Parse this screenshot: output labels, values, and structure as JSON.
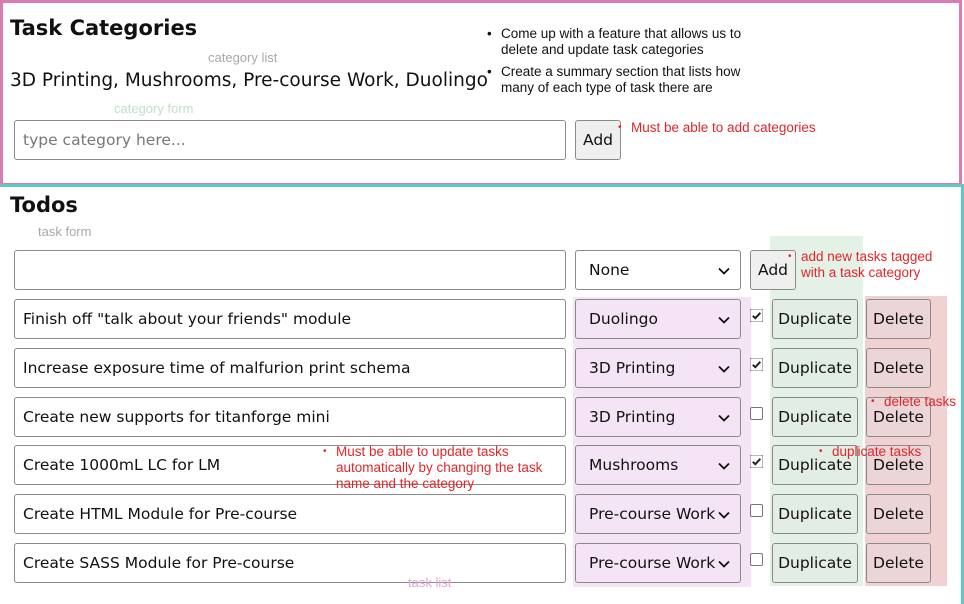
{
  "categories_section": {
    "title": "Task Categories",
    "list_annotation": "category list",
    "category_list_text": "3D Printing, Mushrooms, Pre-course Work, Duolingo",
    "form_annotation": "category form",
    "input_placeholder": "type category here...",
    "add_label": "Add",
    "notes": [
      "Come up with a feature that allows us to delete and update task categories",
      "Create a summary section that lists how many of each type of task there are"
    ],
    "add_note": "Must be able to add categories"
  },
  "todos_section": {
    "title": "Todos",
    "form_annotation": "task form",
    "new_task_value": "",
    "new_task_category": "None",
    "add_label": "Add",
    "add_note": "add new tasks tagged with a task category",
    "delete_note": "delete tasks",
    "duplicate_note": "duplicate tasks",
    "update_note": "Must be able to update tasks automatically by changing the task name and the category",
    "list_annotation": "task list",
    "duplicate_label": "Duplicate",
    "delete_label": "Delete",
    "tasks": [
      {
        "name": "Finish off \"talk about your friends\" module",
        "category": "Duolingo",
        "done": true
      },
      {
        "name": "Increase exposure time of malfurion print schema",
        "category": "3D Printing",
        "done": true
      },
      {
        "name": "Create new supports for titanforge mini",
        "category": "3D Printing",
        "done": false
      },
      {
        "name": "Create 1000mL LC for LM",
        "category": "Mushrooms",
        "done": true
      },
      {
        "name": "Create HTML Module for Pre-course",
        "category": "Pre-course Work",
        "done": false
      },
      {
        "name": "Create SASS Module for Pre-course",
        "category": "Pre-course Work",
        "done": false
      }
    ]
  },
  "colors": {
    "categories_border": "#d77cb5",
    "todos_border": "#5ec9c4",
    "update_highlight": "#f5e4f6",
    "duplicate_highlight": "#e4f1e6",
    "delete_highlight": "#f1d2d3",
    "note_red": "#e0262a"
  }
}
